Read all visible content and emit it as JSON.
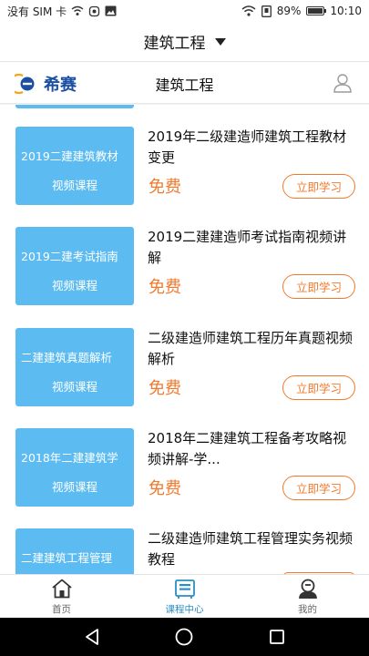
{
  "status_bar": {
    "carrier": "没有 SIM 卡",
    "battery": "89%",
    "battery_level": 0.89,
    "time": "10:10"
  },
  "title_bar": {
    "title": "建筑工程"
  },
  "header": {
    "logo_text": "希赛",
    "title": "建筑工程"
  },
  "courses": [
    {
      "thumb_line1": "2019二建建筑教材",
      "thumb_line2": "视频课程",
      "title": "2019年二级建造师建筑工程教材变更",
      "price": "免费",
      "action": "立即学习"
    },
    {
      "thumb_line1": "2019二建考试指南",
      "thumb_line2": "视频课程",
      "title": "2019二建建造师考试指南视频讲解",
      "price": "免费",
      "action": "立即学习"
    },
    {
      "thumb_line1": "二建建筑真题解析",
      "thumb_line2": "视频课程",
      "title": "二级建造师建筑工程历年真题视频解析",
      "price": "免费",
      "action": "立即学习"
    },
    {
      "thumb_line1": "2018年二建建筑学",
      "thumb_line2": "视频课程",
      "title": "2018年二建建筑工程备考攻略视频讲解-学...",
      "price": "免费",
      "action": "立即学习"
    },
    {
      "thumb_line1": "二建建筑工程管理",
      "thumb_line2": "",
      "title": "二级建造师建筑工程管理实务视频教程",
      "price": "",
      "action": ""
    }
  ],
  "tabs": [
    {
      "label": "首页",
      "icon": "home-icon"
    },
    {
      "label": "课程中心",
      "icon": "course-center-icon"
    },
    {
      "label": "我的",
      "icon": "profile-icon"
    }
  ],
  "colors": {
    "thumb_bg": "#5cbcf2",
    "accent_orange": "#f07a2c",
    "active_tab": "#2a8fc7"
  }
}
